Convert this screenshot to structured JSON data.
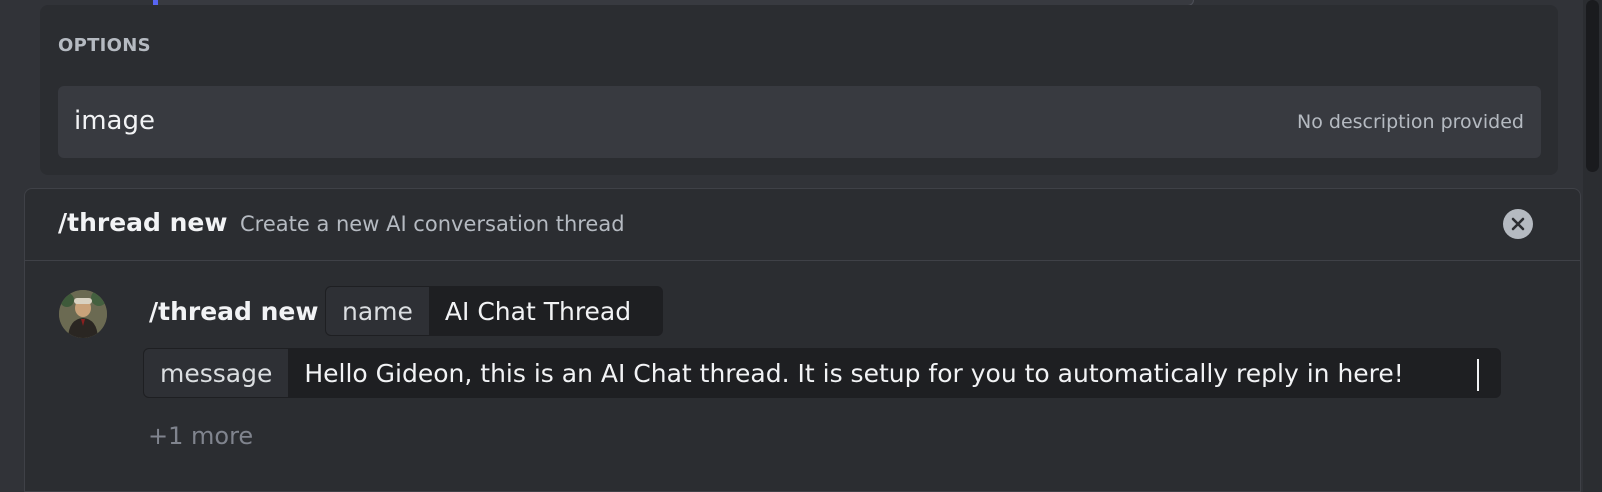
{
  "options": {
    "heading": "OPTIONS",
    "items": [
      {
        "name": "image",
        "description": "No description provided"
      }
    ]
  },
  "command": {
    "title": "/thread new",
    "description": "Create a new AI conversation thread",
    "prefix": "/thread new",
    "params": {
      "name": {
        "key": "name",
        "value": "AI Chat Thread"
      },
      "message": {
        "key": "message",
        "value": "Hello Gideon, this is an AI Chat thread. It is setup for you to automatically reply in here!"
      }
    },
    "more": "+1 more"
  },
  "icons": {
    "close": "close-circle-icon",
    "avatar": "user-avatar"
  },
  "colors": {
    "background": "#313338",
    "panel": "#2b2d31",
    "input": "#1e1f22",
    "accent": "#5865f2"
  }
}
